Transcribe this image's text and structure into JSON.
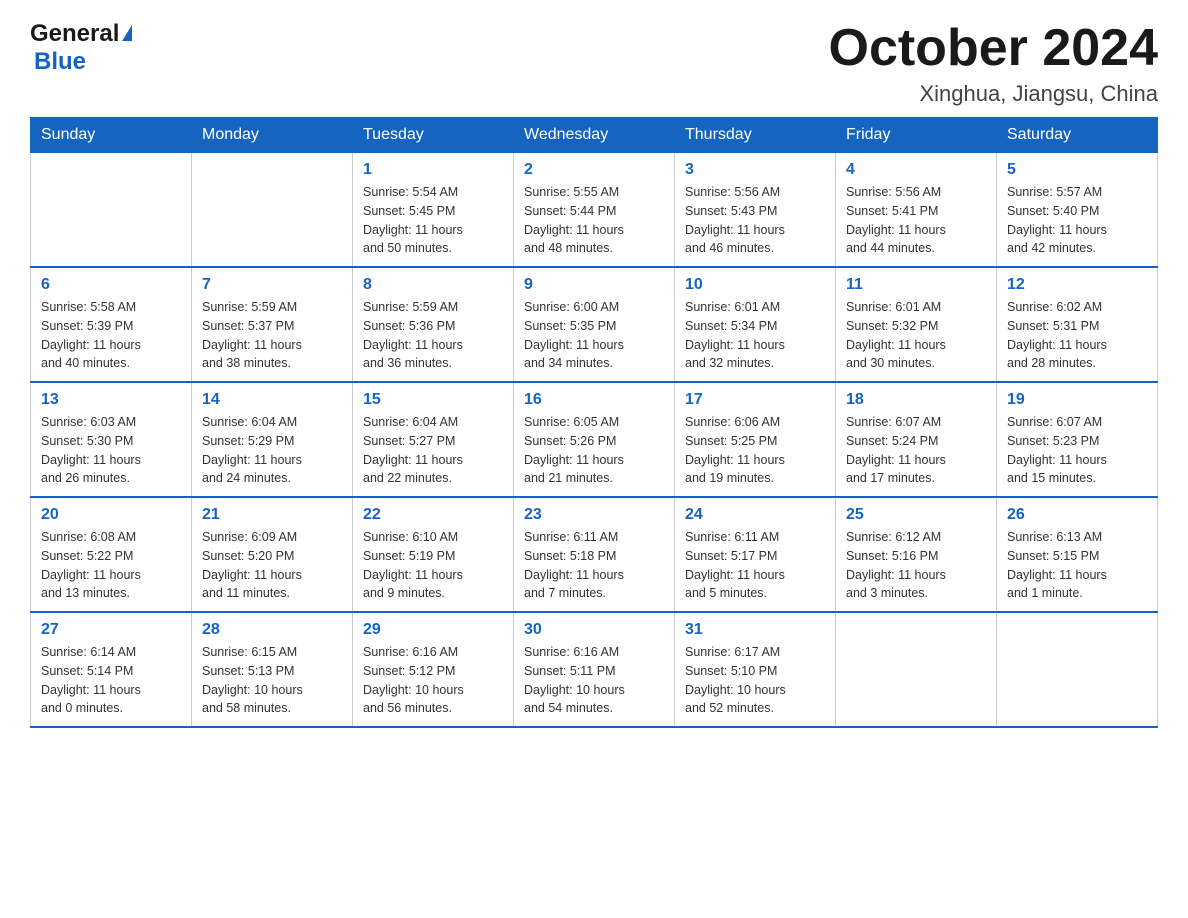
{
  "header": {
    "logo_general": "General",
    "logo_blue": "Blue",
    "title": "October 2024",
    "subtitle": "Xinghua, Jiangsu, China"
  },
  "days_of_week": [
    "Sunday",
    "Monday",
    "Tuesday",
    "Wednesday",
    "Thursday",
    "Friday",
    "Saturday"
  ],
  "weeks": [
    [
      {
        "day": "",
        "info": ""
      },
      {
        "day": "",
        "info": ""
      },
      {
        "day": "1",
        "info": "Sunrise: 5:54 AM\nSunset: 5:45 PM\nDaylight: 11 hours\nand 50 minutes."
      },
      {
        "day": "2",
        "info": "Sunrise: 5:55 AM\nSunset: 5:44 PM\nDaylight: 11 hours\nand 48 minutes."
      },
      {
        "day": "3",
        "info": "Sunrise: 5:56 AM\nSunset: 5:43 PM\nDaylight: 11 hours\nand 46 minutes."
      },
      {
        "day": "4",
        "info": "Sunrise: 5:56 AM\nSunset: 5:41 PM\nDaylight: 11 hours\nand 44 minutes."
      },
      {
        "day": "5",
        "info": "Sunrise: 5:57 AM\nSunset: 5:40 PM\nDaylight: 11 hours\nand 42 minutes."
      }
    ],
    [
      {
        "day": "6",
        "info": "Sunrise: 5:58 AM\nSunset: 5:39 PM\nDaylight: 11 hours\nand 40 minutes."
      },
      {
        "day": "7",
        "info": "Sunrise: 5:59 AM\nSunset: 5:37 PM\nDaylight: 11 hours\nand 38 minutes."
      },
      {
        "day": "8",
        "info": "Sunrise: 5:59 AM\nSunset: 5:36 PM\nDaylight: 11 hours\nand 36 minutes."
      },
      {
        "day": "9",
        "info": "Sunrise: 6:00 AM\nSunset: 5:35 PM\nDaylight: 11 hours\nand 34 minutes."
      },
      {
        "day": "10",
        "info": "Sunrise: 6:01 AM\nSunset: 5:34 PM\nDaylight: 11 hours\nand 32 minutes."
      },
      {
        "day": "11",
        "info": "Sunrise: 6:01 AM\nSunset: 5:32 PM\nDaylight: 11 hours\nand 30 minutes."
      },
      {
        "day": "12",
        "info": "Sunrise: 6:02 AM\nSunset: 5:31 PM\nDaylight: 11 hours\nand 28 minutes."
      }
    ],
    [
      {
        "day": "13",
        "info": "Sunrise: 6:03 AM\nSunset: 5:30 PM\nDaylight: 11 hours\nand 26 minutes."
      },
      {
        "day": "14",
        "info": "Sunrise: 6:04 AM\nSunset: 5:29 PM\nDaylight: 11 hours\nand 24 minutes."
      },
      {
        "day": "15",
        "info": "Sunrise: 6:04 AM\nSunset: 5:27 PM\nDaylight: 11 hours\nand 22 minutes."
      },
      {
        "day": "16",
        "info": "Sunrise: 6:05 AM\nSunset: 5:26 PM\nDaylight: 11 hours\nand 21 minutes."
      },
      {
        "day": "17",
        "info": "Sunrise: 6:06 AM\nSunset: 5:25 PM\nDaylight: 11 hours\nand 19 minutes."
      },
      {
        "day": "18",
        "info": "Sunrise: 6:07 AM\nSunset: 5:24 PM\nDaylight: 11 hours\nand 17 minutes."
      },
      {
        "day": "19",
        "info": "Sunrise: 6:07 AM\nSunset: 5:23 PM\nDaylight: 11 hours\nand 15 minutes."
      }
    ],
    [
      {
        "day": "20",
        "info": "Sunrise: 6:08 AM\nSunset: 5:22 PM\nDaylight: 11 hours\nand 13 minutes."
      },
      {
        "day": "21",
        "info": "Sunrise: 6:09 AM\nSunset: 5:20 PM\nDaylight: 11 hours\nand 11 minutes."
      },
      {
        "day": "22",
        "info": "Sunrise: 6:10 AM\nSunset: 5:19 PM\nDaylight: 11 hours\nand 9 minutes."
      },
      {
        "day": "23",
        "info": "Sunrise: 6:11 AM\nSunset: 5:18 PM\nDaylight: 11 hours\nand 7 minutes."
      },
      {
        "day": "24",
        "info": "Sunrise: 6:11 AM\nSunset: 5:17 PM\nDaylight: 11 hours\nand 5 minutes."
      },
      {
        "day": "25",
        "info": "Sunrise: 6:12 AM\nSunset: 5:16 PM\nDaylight: 11 hours\nand 3 minutes."
      },
      {
        "day": "26",
        "info": "Sunrise: 6:13 AM\nSunset: 5:15 PM\nDaylight: 11 hours\nand 1 minute."
      }
    ],
    [
      {
        "day": "27",
        "info": "Sunrise: 6:14 AM\nSunset: 5:14 PM\nDaylight: 11 hours\nand 0 minutes."
      },
      {
        "day": "28",
        "info": "Sunrise: 6:15 AM\nSunset: 5:13 PM\nDaylight: 10 hours\nand 58 minutes."
      },
      {
        "day": "29",
        "info": "Sunrise: 6:16 AM\nSunset: 5:12 PM\nDaylight: 10 hours\nand 56 minutes."
      },
      {
        "day": "30",
        "info": "Sunrise: 6:16 AM\nSunset: 5:11 PM\nDaylight: 10 hours\nand 54 minutes."
      },
      {
        "day": "31",
        "info": "Sunrise: 6:17 AM\nSunset: 5:10 PM\nDaylight: 10 hours\nand 52 minutes."
      },
      {
        "day": "",
        "info": ""
      },
      {
        "day": "",
        "info": ""
      }
    ]
  ]
}
